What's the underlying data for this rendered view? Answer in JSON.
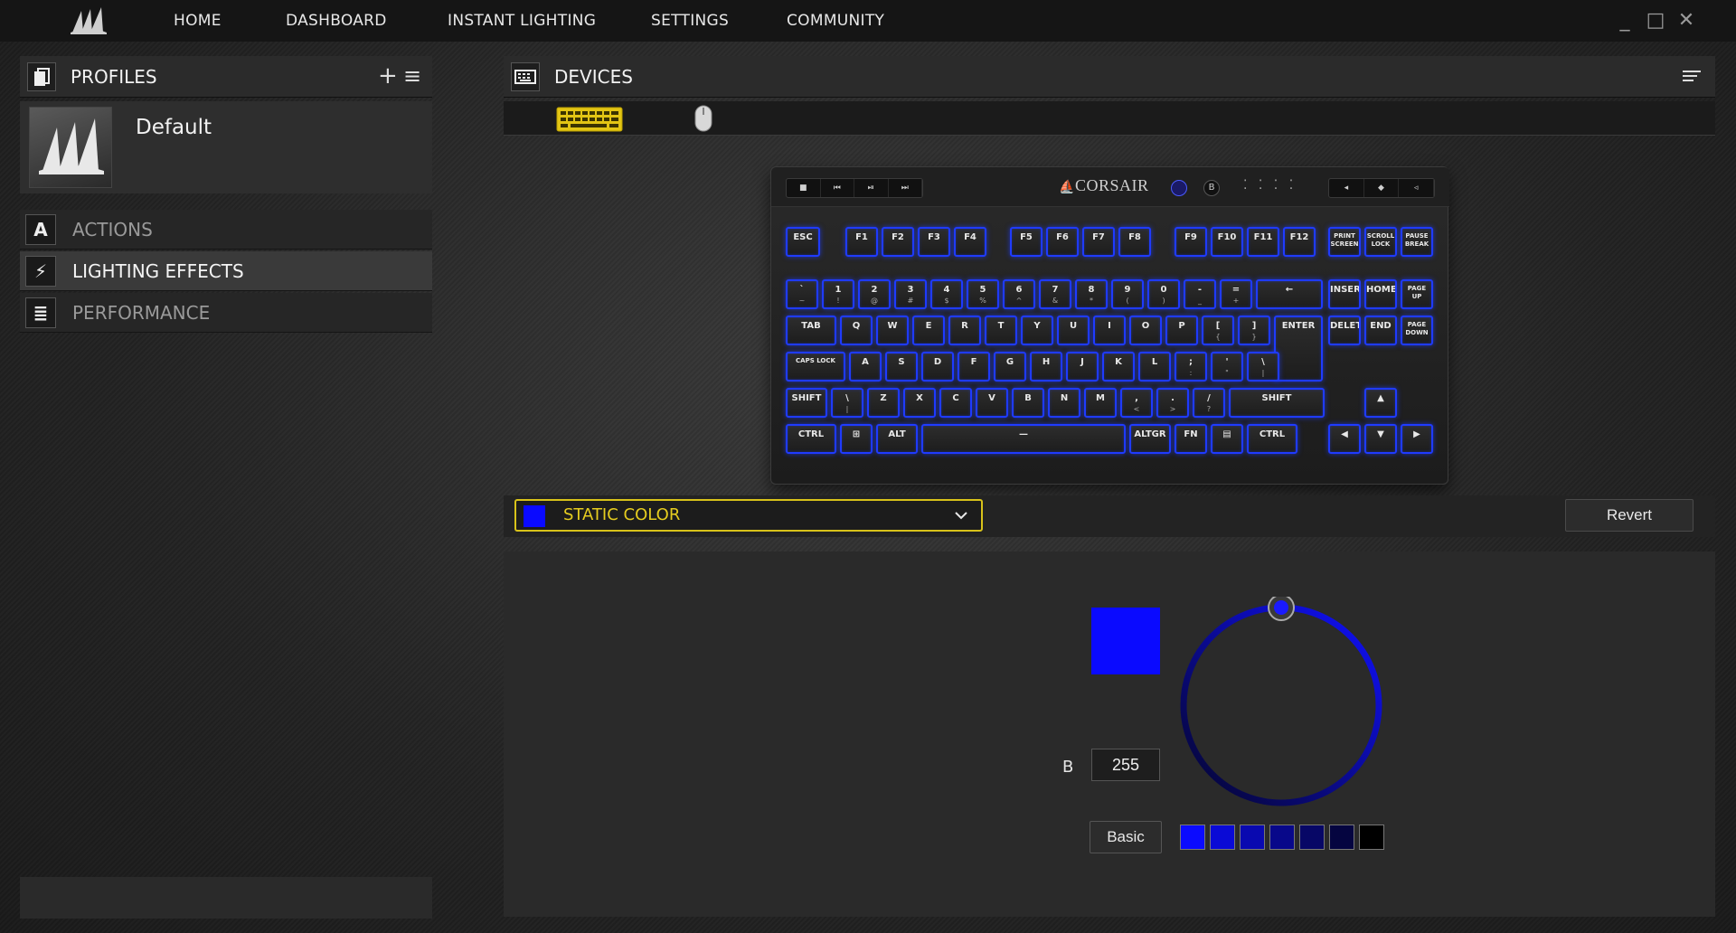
{
  "nav": {
    "items": [
      "HOME",
      "DASHBOARD",
      "INSTANT LIGHTING",
      "SETTINGS",
      "COMMUNITY"
    ]
  },
  "window_controls": {
    "minimize": "_",
    "maximize": "□",
    "close": "✕"
  },
  "profiles": {
    "title": "PROFILES",
    "add_label": "+",
    "menu_label": "≡",
    "current": "Default"
  },
  "sidebar": {
    "items": [
      {
        "label": "ACTIONS",
        "icon": "A"
      },
      {
        "label": "LIGHTING EFFECTS",
        "icon": "⚡"
      },
      {
        "label": "PERFORMANCE",
        "icon": "≣"
      }
    ]
  },
  "devices": {
    "title": "DEVICES"
  },
  "keyboard": {
    "brand": "CORSAIR",
    "media_left": [
      "■",
      "⏮",
      "⏯",
      "⏭"
    ],
    "media_right": [
      "◂",
      "◆",
      "◃"
    ],
    "indicator_b": "B",
    "indicator_dots": "⁚ ⁚ ⁚ ⁚",
    "rows": {
      "f": [
        "ESC",
        "F1",
        "F2",
        "F3",
        "F4",
        "F5",
        "F6",
        "F7",
        "F8",
        "F9",
        "F10",
        "F11",
        "F12",
        "PRINT SCREEN",
        "SCROLL LOCK",
        "PAUSE BREAK"
      ],
      "num": [
        "`",
        "1",
        "2",
        "3",
        "4",
        "5",
        "6",
        "7",
        "8",
        "9",
        "0",
        "-",
        "=",
        "←",
        "INSERT",
        "HOME",
        "PAGE UP"
      ],
      "num_shift": [
        "~",
        "!",
        "@",
        "#",
        "$",
        "%",
        "^",
        "&",
        "*",
        "(",
        ")",
        "_",
        "+",
        "",
        "",
        "",
        ""
      ],
      "top": [
        "TAB",
        "Q",
        "W",
        "E",
        "R",
        "T",
        "Y",
        "U",
        "I",
        "O",
        "P",
        "[",
        "]",
        "ENTER",
        "DELETE",
        "END",
        "PAGE DOWN"
      ],
      "top_shift": [
        "",
        "",
        "",
        "",
        "",
        "",
        "",
        "",
        "",
        "",
        "",
        "{",
        "}",
        "",
        "",
        "",
        ""
      ],
      "home": [
        "CAPS LOCK",
        "A",
        "S",
        "D",
        "F",
        "G",
        "H",
        "J",
        "K",
        "L",
        ";",
        "'",
        "\\"
      ],
      "home_shift": [
        "",
        "",
        "",
        "",
        "",
        "",
        "",
        "",
        "",
        "",
        ":",
        "\"",
        "|"
      ],
      "bottom": [
        "SHIFT",
        "\\",
        "Z",
        "X",
        "C",
        "V",
        "B",
        "N",
        "M",
        ",",
        ".",
        "/",
        "SHIFT",
        "▲"
      ],
      "bottom_shift": [
        "",
        "|",
        "",
        "",
        "",
        "",
        "",
        "",
        "",
        "<",
        ">",
        "?",
        "",
        ""
      ],
      "space": [
        "CTRL",
        "⊞",
        "ALT",
        "—",
        "ALTGR",
        "FN",
        "▤",
        "CTRL",
        "◀",
        "▼",
        "▶"
      ]
    }
  },
  "effect": {
    "label": "STATIC COLOR",
    "color": "#0a0aff",
    "revert_label": "Revert"
  },
  "color_editor": {
    "channel_label": "B",
    "channel_value": "255",
    "preview_color": "#0a0aff",
    "basic_label": "Basic",
    "presets": [
      "#0b0bff",
      "#0a0ad6",
      "#0909b0",
      "#08088a",
      "#070766",
      "#050540",
      "#000000"
    ]
  },
  "colors": {
    "accent_yellow": "#e6cd1f",
    "key_glow": "#1f3bff"
  }
}
